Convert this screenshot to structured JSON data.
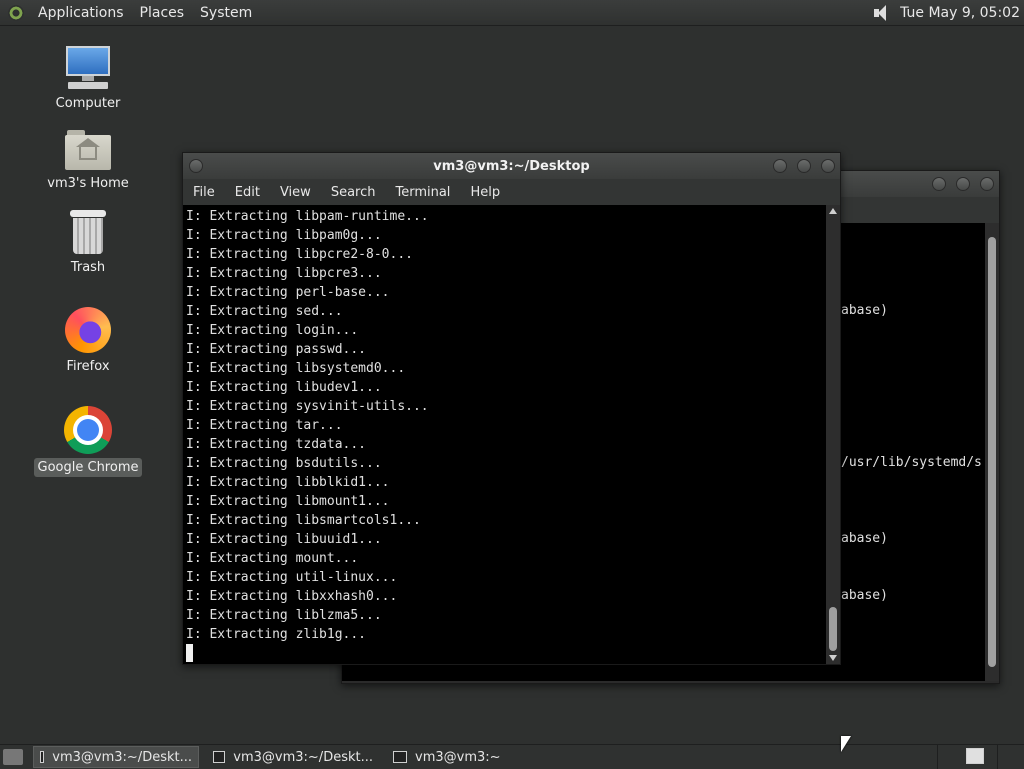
{
  "top_panel": {
    "applications": "Applications",
    "places": "Places",
    "system": "System",
    "clock": "Tue May  9, 05:02"
  },
  "desktop_icons": [
    {
      "label": "Computer"
    },
    {
      "label": "vm3's Home"
    },
    {
      "label": "Trash"
    },
    {
      "label": "Firefox"
    },
    {
      "label": "Google Chrome"
    }
  ],
  "front_window": {
    "title": "vm3@vm3:~/Desktop",
    "menu": [
      "File",
      "Edit",
      "View",
      "Search",
      "Terminal",
      "Help"
    ],
    "lines": [
      "I: Extracting libpam-runtime...",
      "I: Extracting libpam0g...",
      "I: Extracting libpcre2-8-0...",
      "I: Extracting libpcre3...",
      "I: Extracting perl-base...",
      "I: Extracting sed...",
      "I: Extracting login...",
      "I: Extracting passwd...",
      "I: Extracting libsystemd0...",
      "I: Extracting libudev1...",
      "I: Extracting sysvinit-utils...",
      "I: Extracting tar...",
      "I: Extracting tzdata...",
      "I: Extracting bsdutils...",
      "I: Extracting libblkid1...",
      "I: Extracting libmount1...",
      "I: Extracting libsmartcols1...",
      "I: Extracting libuuid1...",
      "I: Extracting mount...",
      "I: Extracting util-linux...",
      "I: Extracting libxxhash0...",
      "I: Extracting liblzma5...",
      "I: Extracting zlib1g..."
    ]
  },
  "back_window": {
    "fragments": [
      {
        "text": "abase)",
        "row": 4
      },
      {
        "text": "/usr/lib/systemd/s",
        "row": 12
      },
      {
        "text": "abase)",
        "row": 16
      },
      {
        "text": "abase)",
        "row": 19
      }
    ]
  },
  "taskbar": {
    "tasks": [
      {
        "label": "vm3@vm3:~/Deskt...",
        "active": true
      },
      {
        "label": "vm3@vm3:~/Deskt...",
        "active": false
      },
      {
        "label": "vm3@vm3:~",
        "active": false
      }
    ]
  },
  "colors": {
    "desktop_bg": "#2e302f",
    "terminal_bg": "#000000",
    "terminal_fg": "#e0e0e0"
  }
}
